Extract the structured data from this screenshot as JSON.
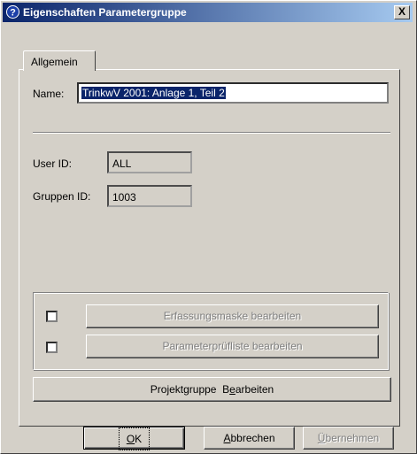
{
  "window": {
    "title": "Eigenschaften Parametergruppe",
    "close_label": "X"
  },
  "tabs": [
    {
      "label": "Allgemein"
    }
  ],
  "form": {
    "name_label": "Name:",
    "name_value": "TrinkwV 2001: Anlage 1, Teil 2",
    "user_id_label": "User ID:",
    "user_id_value": "ALL",
    "gruppen_id_label": "Gruppen ID:",
    "gruppen_id_value": "1003"
  },
  "group": {
    "erfassungsmaske_button": "Erfassungsmaske bearbeiten",
    "parameterpruefliste_button": "Parameterprüfliste bearbeiten",
    "erfassungsmaske_checked": false,
    "parameterpruefliste_checked": false
  },
  "projektgruppe_button": {
    "prefix": "Projektgruppe  B",
    "accel": "e",
    "suffix": "arbeiten"
  },
  "footer": {
    "ok": {
      "accel": "O",
      "rest": "K"
    },
    "abbrechen": {
      "accel": "A",
      "rest": "bbrechen"
    },
    "uebernehmen": {
      "accel": "Ü",
      "rest": "bernehmen"
    }
  },
  "icons": {
    "title": "help-question-icon"
  },
  "colors": {
    "titlebar_start": "#0a246a",
    "titlebar_end": "#a6caf0",
    "face": "#d4d0c8",
    "selection": "#0a246a"
  }
}
